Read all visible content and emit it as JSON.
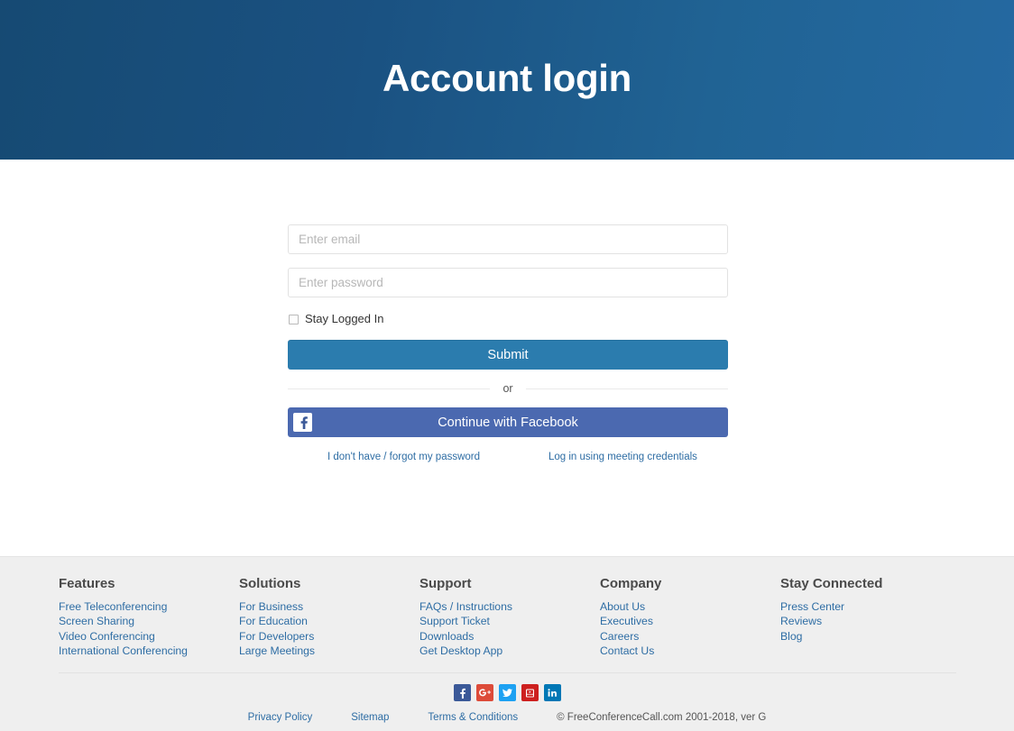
{
  "hero": {
    "title": "Account login",
    "gradient_from": "#164a73",
    "gradient_to": "#2569a1"
  },
  "form": {
    "email_placeholder": "Enter email",
    "email_value": "",
    "password_placeholder": "Enter password",
    "password_value": "",
    "stay_logged_in_label": "Stay Logged In",
    "stay_logged_in_checked": false,
    "submit_label": "Submit",
    "submit_color": "#2b7cae",
    "divider_label": "or",
    "facebook_label": "Continue with Facebook",
    "facebook_color": "#4b69b0",
    "forgot_link": "I don't have / forgot my password",
    "meeting_credentials_link": "Log in using meeting credentials",
    "link_color": "#2e6da4"
  },
  "footer": {
    "background": "#efefef",
    "columns": [
      {
        "heading": "Features",
        "links": [
          "Free Teleconferencing",
          "Screen Sharing",
          "Video Conferencing",
          "International Conferencing"
        ]
      },
      {
        "heading": "Solutions",
        "links": [
          "For Business",
          "For Education",
          "For Developers",
          "Large Meetings"
        ]
      },
      {
        "heading": "Support",
        "links": [
          "FAQs / Instructions",
          "Support Ticket",
          "Downloads",
          "Get Desktop App"
        ]
      },
      {
        "heading": "Company",
        "links": [
          "About Us",
          "Executives",
          "Careers",
          "Contact Us"
        ]
      },
      {
        "heading": "Stay Connected",
        "links": [
          "Press Center",
          "Reviews",
          "Blog"
        ]
      }
    ],
    "socials": [
      {
        "name": "facebook-icon",
        "color": "#3b5998"
      },
      {
        "name": "google-plus-icon",
        "color": "#dd4b39"
      },
      {
        "name": "twitter-icon",
        "color": "#1da1f2"
      },
      {
        "name": "youtube-icon",
        "color": "#cd201f"
      },
      {
        "name": "linkedin-icon",
        "color": "#0077b5"
      }
    ],
    "bottom_links": [
      "Privacy Policy",
      "Sitemap",
      "Terms & Conditions"
    ],
    "copyright": "© FreeConferenceCall.com 2001-2018, ver G"
  }
}
